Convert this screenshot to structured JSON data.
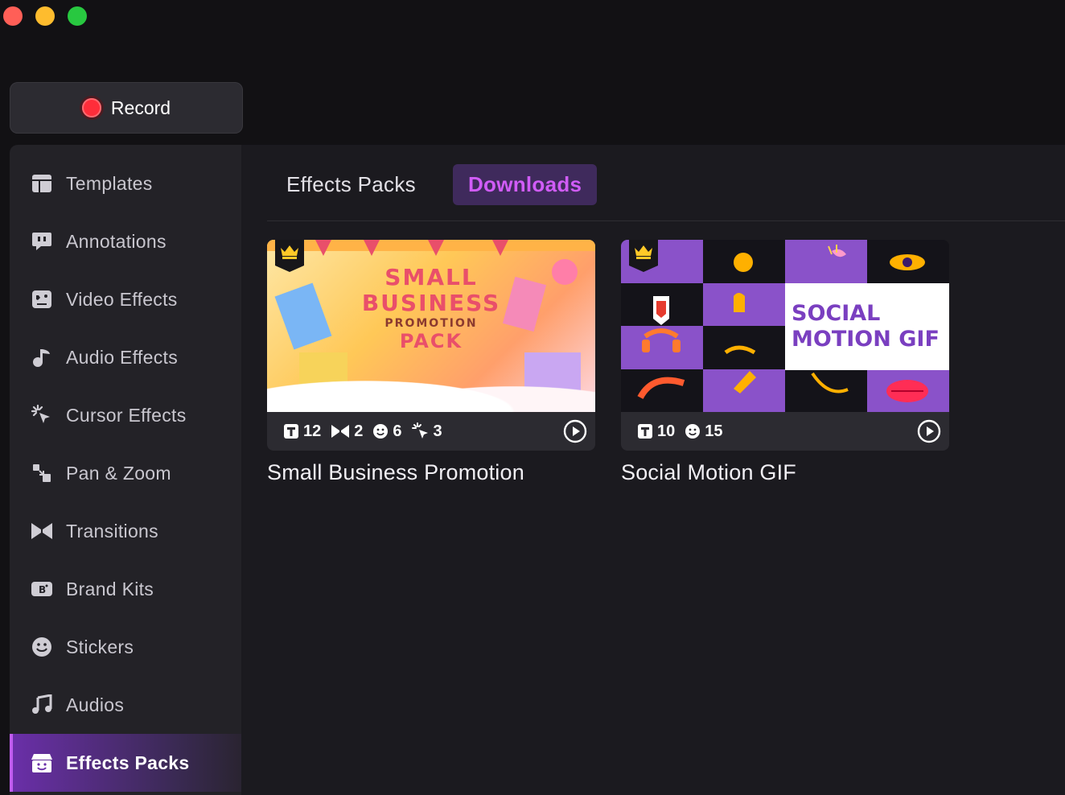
{
  "window": {
    "controls": [
      "close",
      "minimize",
      "zoom"
    ]
  },
  "record": {
    "label": "Record"
  },
  "sidebar": {
    "items": [
      {
        "label": "Templates",
        "icon": "templates-icon"
      },
      {
        "label": "Annotations",
        "icon": "annotations-icon"
      },
      {
        "label": "Video Effects",
        "icon": "video-effects-icon"
      },
      {
        "label": "Audio Effects",
        "icon": "audio-effects-icon"
      },
      {
        "label": "Cursor Effects",
        "icon": "cursor-effects-icon"
      },
      {
        "label": "Pan & Zoom",
        "icon": "pan-zoom-icon"
      },
      {
        "label": "Transitions",
        "icon": "transitions-icon"
      },
      {
        "label": "Brand Kits",
        "icon": "brand-kits-icon"
      },
      {
        "label": "Stickers",
        "icon": "stickers-icon"
      },
      {
        "label": "Audios",
        "icon": "audios-icon"
      },
      {
        "label": "Effects Packs",
        "icon": "effects-packs-icon",
        "active": true
      }
    ]
  },
  "tabs": [
    {
      "label": "Effects Packs",
      "active": false
    },
    {
      "label": "Downloads",
      "active": true
    }
  ],
  "cards": [
    {
      "title": "Small Business Promotion",
      "premium": true,
      "thumb_text": [
        "SMALL",
        "BUSINESS",
        "PROMOTION",
        "PACK"
      ],
      "stats": {
        "titles": "12",
        "transitions": "2",
        "stickers": "6",
        "cursor_effects": "3"
      }
    },
    {
      "title": "Social Motion GIF",
      "premium": true,
      "thumb_text": [
        "SOCIAL",
        "MOTION GIF"
      ],
      "stats": {
        "titles": "10",
        "stickers": "15"
      }
    }
  ],
  "colors": {
    "accent": "#d05cf7",
    "active_tab_bg": "#3f2a5c",
    "record_red": "#ff2d3a",
    "sidebar_active": "#6a2fa8"
  }
}
